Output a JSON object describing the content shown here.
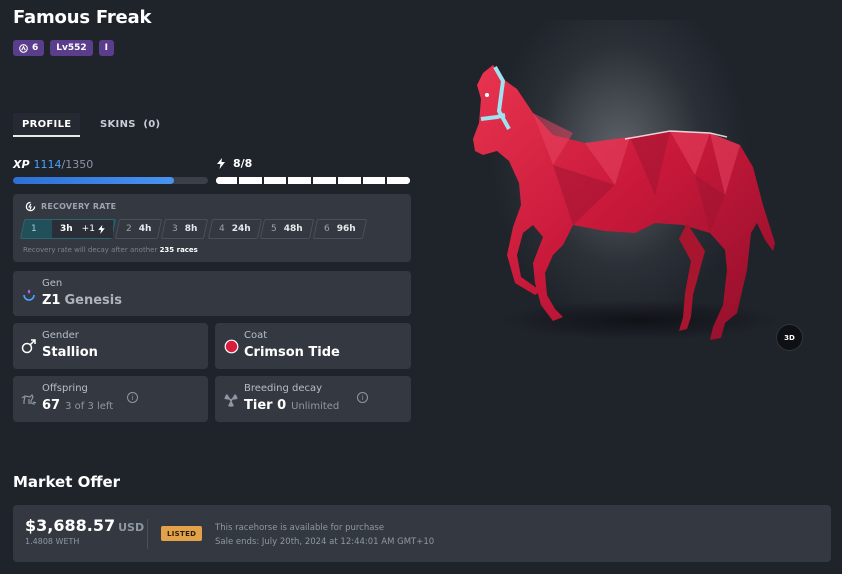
{
  "horse": {
    "name": "Famous Freak",
    "badges": [
      {
        "icon": "rank-icon",
        "label": "6"
      },
      {
        "icon": "",
        "label": "Lv552"
      },
      {
        "icon": "",
        "label": "I"
      }
    ]
  },
  "tabs": [
    {
      "label": "PROFILE",
      "active": true
    },
    {
      "label": "SKINS",
      "count": "(0)",
      "active": false
    }
  ],
  "xp": {
    "label": "XP",
    "current": "1114",
    "max": "/1350",
    "progress": 0.825
  },
  "energy": {
    "label": "8/8",
    "segments": 8,
    "filled": 8
  },
  "recovery": {
    "title": "RECOVERY RATE",
    "current": {
      "level": "1",
      "time": "3h",
      "bonus": "+1"
    },
    "levels": [
      {
        "level": "2",
        "time": "4h"
      },
      {
        "level": "3",
        "time": "8h"
      },
      {
        "level": "4",
        "time": "24h"
      },
      {
        "level": "5",
        "time": "48h"
      },
      {
        "level": "6",
        "time": "96h"
      }
    ],
    "note": "Recovery rate will decay after another",
    "note_races": "235 races"
  },
  "stats": {
    "gen": {
      "label": "Gen",
      "value": "Z1",
      "sub": "Genesis"
    },
    "gender": {
      "label": "Gender",
      "value": "Stallion"
    },
    "coat": {
      "label": "Coat",
      "value": "Crimson Tide",
      "color": "#d81e3c"
    },
    "offspring": {
      "label": "Offspring",
      "value": "67",
      "sub": "3 of 3 left"
    },
    "decay": {
      "label": "Breeding decay",
      "value": "Tier 0",
      "sub": "Unlimited"
    }
  },
  "viewer": {
    "button_3d": "3D"
  },
  "market": {
    "title": "Market Offer",
    "price": "$3,688.57",
    "currency": "USD",
    "weth": "1.4808 WETH",
    "status": "LISTED",
    "message": "This racehorse is available for purchase",
    "ends": "Sale ends: July 20th, 2024 at 12:44:01 AM GMT+10"
  },
  "colors": {
    "accent": "#4ca2ff",
    "badge": "#5a3e8c",
    "listed": "#e3a24a",
    "horse": "#d81e3c"
  }
}
